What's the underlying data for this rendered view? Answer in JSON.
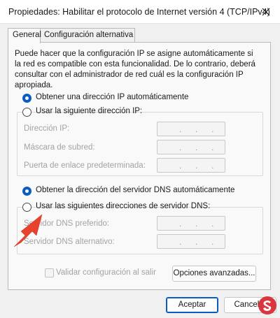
{
  "window": {
    "title": "Propiedades: Habilitar el protocolo de Internet versión 4 (TCP/IPv4)"
  },
  "tabs": [
    {
      "label": "General",
      "active": true
    },
    {
      "label": "Configuración alternativa",
      "active": false
    }
  ],
  "intro_text": "Puede hacer que la configuración IP se asigne automáticamente si la red es compatible con esta funcionalidad. De lo contrario, deberá consultar con el administrador de red cuál es la configuración IP apropiada.",
  "ip_section": {
    "auto_option": {
      "label": "Obtener una dirección IP automáticamente",
      "selected": true
    },
    "manual_option": {
      "label": "Usar la siguiente dirección IP:",
      "selected": false
    },
    "fields": [
      {
        "label": "Dirección IP:",
        "value": ". . ."
      },
      {
        "label": "Máscara de subred:",
        "value": ". . ."
      },
      {
        "label": "Puerta de enlace predeterminada:",
        "value": ". . ."
      }
    ]
  },
  "dns_section": {
    "auto_option": {
      "label": "Obtener la dirección del servidor DNS automáticamente",
      "selected": true
    },
    "manual_option": {
      "label": "Usar las siguientes direcciones de servidor DNS:",
      "selected": false
    },
    "fields": [
      {
        "label": "Servidor DNS preferido:",
        "value": ". . ."
      },
      {
        "label": "Servidor DNS alternativo:",
        "value": ". . ."
      }
    ]
  },
  "validate_checkbox": {
    "label": "Validar configuración al salir",
    "checked": false,
    "enabled": false
  },
  "buttons": {
    "advanced": "Opciones avanzadas...",
    "ok": "Aceptar",
    "cancel": "Cancelar"
  },
  "colors": {
    "accent": "#0a5cc2",
    "arrow": "#e8412c"
  },
  "icons": [
    "close-icon",
    "red-arrow-annotation",
    "watermark-logo"
  ]
}
